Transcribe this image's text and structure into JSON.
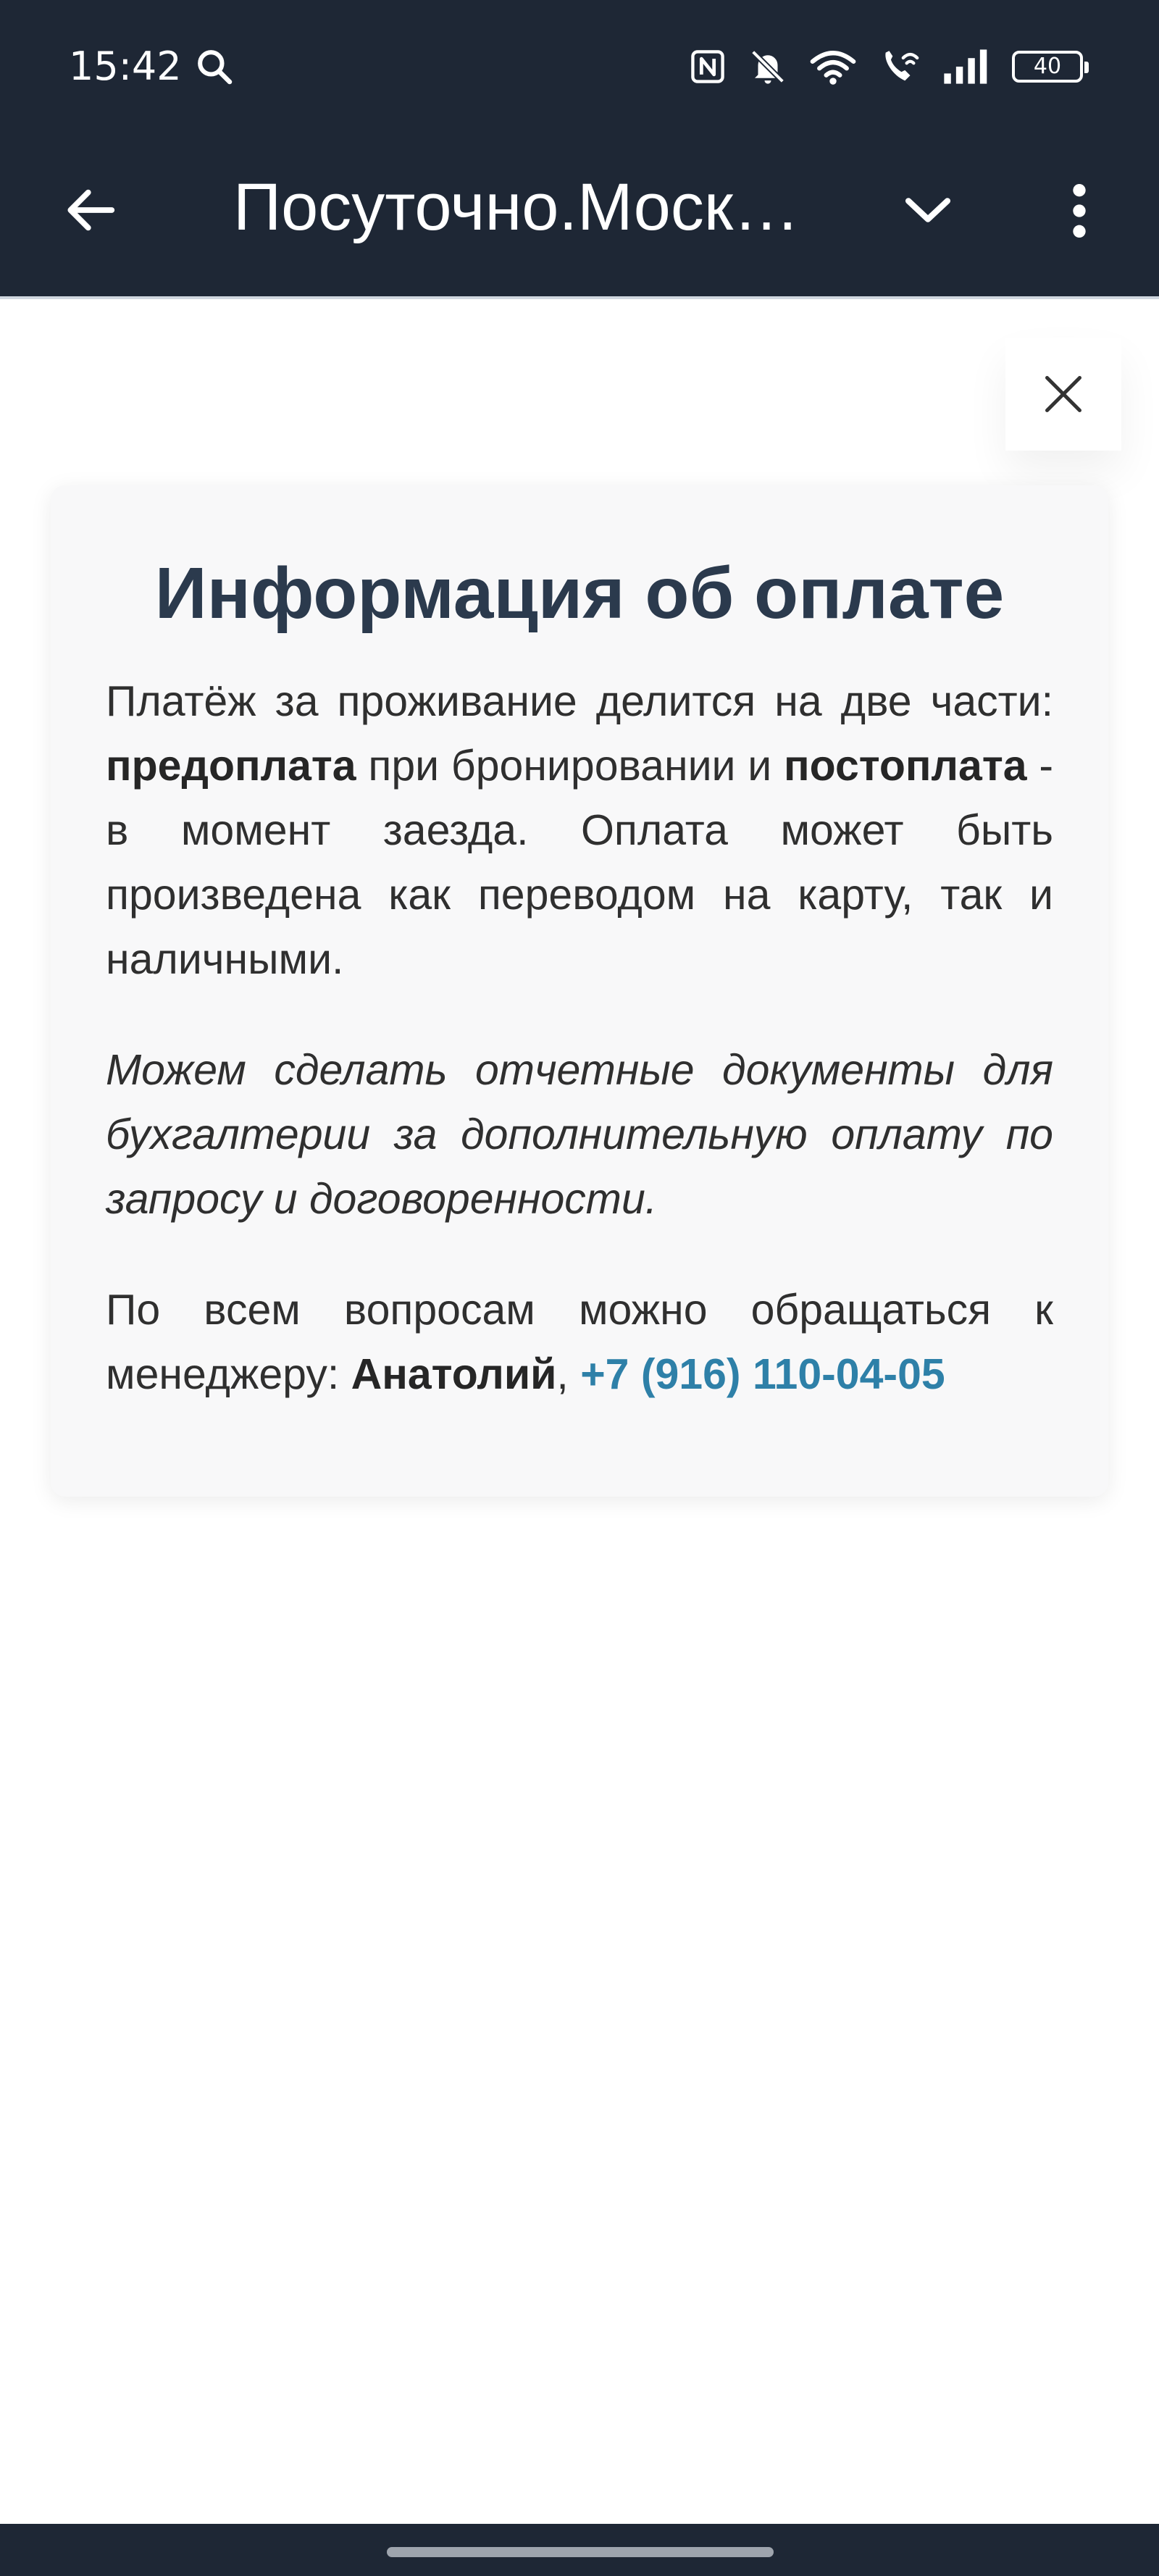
{
  "status_bar": {
    "time": "15:42",
    "icons": [
      "search-icon",
      "nfc-icon",
      "bell-off-icon",
      "wifi-icon",
      "wifi-calling-icon",
      "signal-icon",
      "battery-icon"
    ],
    "battery_level": "40"
  },
  "app_bar": {
    "title": "Посуточно.Моск…",
    "icons": [
      "arrow-left-icon",
      "chevron-down-icon",
      "more-vertical-icon"
    ]
  },
  "dialog": {
    "close_icon": "close-icon",
    "title": "Информация об оплате",
    "paragraph1": {
      "part1": "Платёж за проживание делится на две части: ",
      "bold1": "предоплата",
      "part2": " при бронировании и ",
      "bold2": "постоплата",
      "part3": " - в момент заезда. Оплата может быть произведена как переводом на карту, так и наличными."
    },
    "paragraph2": "Можем сделать отчетные документы для бухгалтерии за дополнительную оплату по запросу и договоренности.",
    "paragraph3": {
      "part1": "По всем вопросам можно обращаться к менеджеру: ",
      "manager_name": "Анатолий",
      "separator": ", ",
      "phone": "+7 (916) 110-04-05"
    }
  },
  "colors": {
    "bars_background": "#1e2735",
    "title_color": "#2b3a4d",
    "link_color": "#2e80a8",
    "card_background": "#f8f8f9"
  }
}
